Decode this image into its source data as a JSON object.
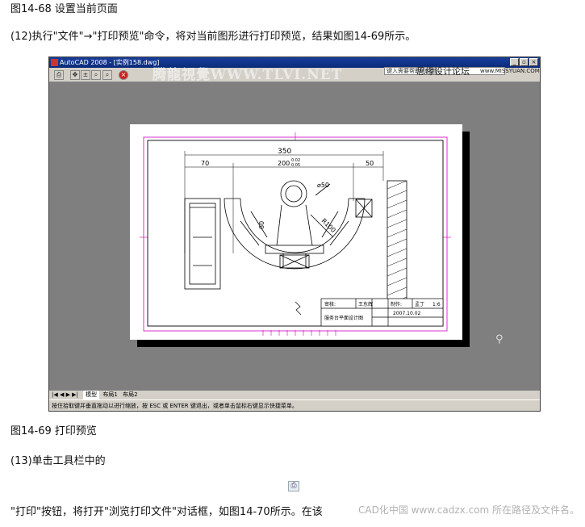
{
  "doc": {
    "fig68_caption": "图14-68 设置当前页面",
    "step12": "(12)执行\"文件\"→\"打印预览\"命令，将对当前图形进行打印预览，结果如图14-69所示。",
    "fig69_caption": "图14-69 打印预览",
    "step13": "(13)单击工具栏中的",
    "step13_cont": "\"打印\"按钮，将打开\"浏览打印文件\"对话框，如图14-70所示。在该",
    "bottom_watermark": "CAD化中国 www.cadzx.com 所在路径及文件名。"
  },
  "window": {
    "title": "AutoCAD 2008 - [实例158.dwg]",
    "controls": [
      "_",
      "▫",
      "×"
    ],
    "forum_input": "键入需要帮助的问题",
    "forum_mark": "思缘设计论坛",
    "forum_site": "www.MISSYUAN.COM",
    "watermark": "腾龍視覺WWW.TLVI.NET",
    "toolbar_icons": [
      "print-icon",
      "pan-icon",
      "zoom-realtime-icon",
      "zoom-window-icon",
      "zoom-original-icon",
      "close-preview-icon"
    ],
    "tabs": {
      "nav": "|◀ ◀ ▶ ▶|",
      "model": "模型",
      "layout1": "布局1",
      "layout2": "布局2"
    },
    "status_text": "按住拾取键并垂直拖动以进行缩放，按 ESC 或 ENTER 键退出，或者单击鼠标右键显示快捷菜单。"
  },
  "drawing": {
    "dim_total": "350",
    "dim_left": "70",
    "dim_mid": "200",
    "dim_mid_tol_upper": "0.02",
    "dim_mid_tol_lower": "0.05",
    "dim_right": "50",
    "dim_dia": "⌀50",
    "dim_radius": "R100",
    "dim_height": "60",
    "title_block": {
      "review_label": "审核:",
      "reviewer": "王东辉",
      "maker_label": "制作:",
      "maker": "孟丁",
      "scale": "1:6",
      "drawing_name": "服务台平面设计图",
      "date": "2007.10.02"
    }
  },
  "colors": {
    "titlebar": "#0a2a7a",
    "frame_magenta": "#d000c0",
    "preview_bg": "#7f7f7f"
  }
}
